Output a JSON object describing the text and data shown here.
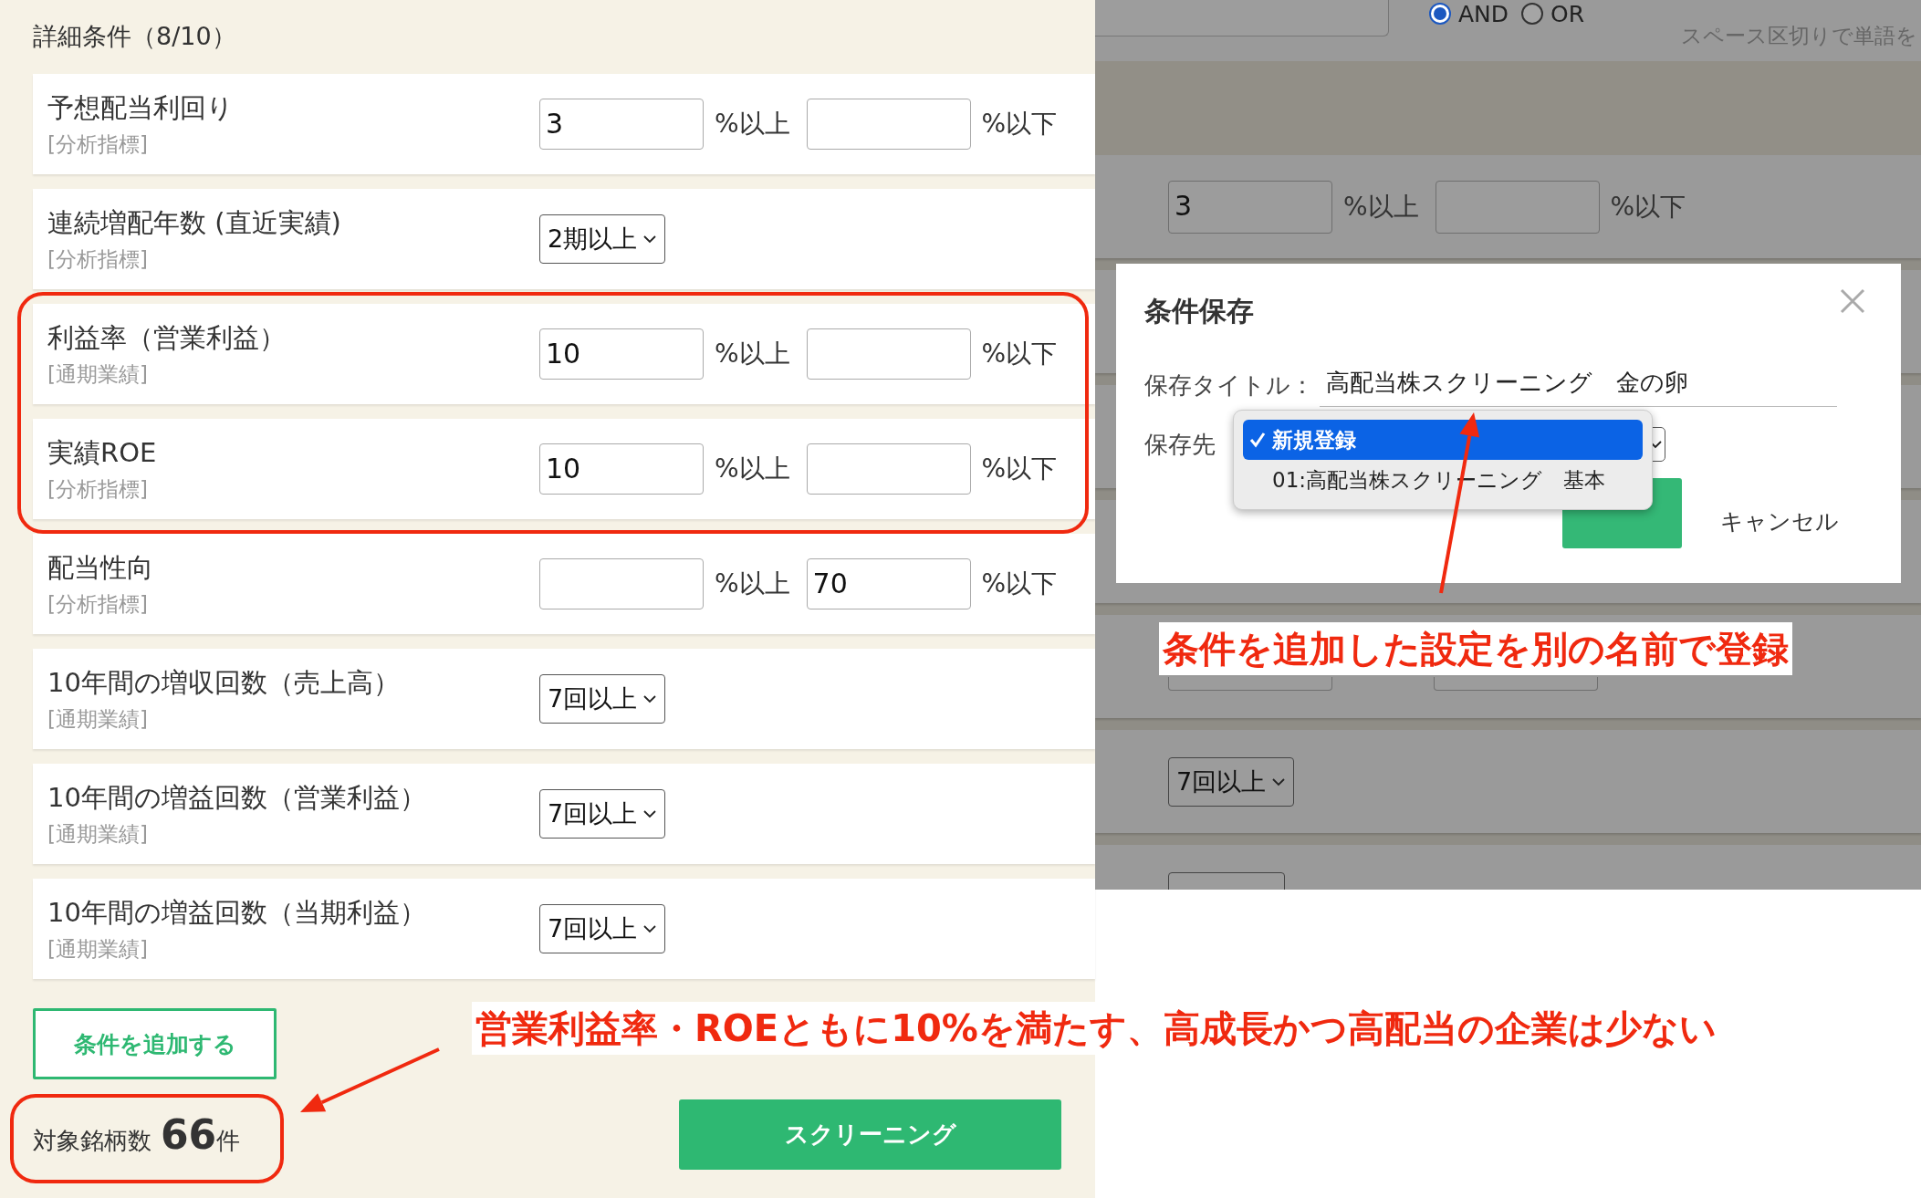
{
  "conditions_panel": {
    "heading": "詳細条件（8/10）",
    "rows": [
      {
        "kind": "range",
        "label": "予想配当利回り",
        "category": "[分析指標]",
        "min_value": "3",
        "min_suffix": "%以上",
        "max_suffix": "%以下"
      },
      {
        "kind": "select",
        "label": "連続増配年数 (直近実績)",
        "category": "[分析指標]",
        "value": "2期以上"
      },
      {
        "kind": "range",
        "label": "利益率（営業利益）",
        "category": "[通期業績]",
        "min_value": "10",
        "min_suffix": "%以上",
        "max_suffix": "%以下"
      },
      {
        "kind": "range",
        "label": "実績ROE",
        "category": "[分析指標]",
        "min_value": "10",
        "min_suffix": "%以上",
        "max_suffix": "%以下"
      },
      {
        "kind": "range",
        "label": "配当性向",
        "category": "[分析指標]",
        "min_suffix": "%以上",
        "max_value": "70",
        "max_suffix": "%以下"
      },
      {
        "kind": "select",
        "label": "10年間の増収回数（売上高）",
        "category": "[通期業績]",
        "value": "7回以上"
      },
      {
        "kind": "select",
        "label": "10年間の増益回数（営業利益）",
        "category": "[通期業績]",
        "value": "7回以上"
      },
      {
        "kind": "select",
        "label": "10年間の増益回数（当期利益）",
        "category": "[通期業績]",
        "value": "7回以上"
      }
    ],
    "add_button": "条件を追加する",
    "result": {
      "label": "対象銘柄数",
      "count": "66",
      "unit": "件"
    },
    "screening_button": "スクリーニング"
  },
  "background_page": {
    "radios": [
      {
        "label": "AND",
        "selected": true
      },
      {
        "label": "OR",
        "selected": false
      }
    ],
    "hint": "スペース区切りで単語を",
    "rows": [
      {
        "kind": "range",
        "min_value": "3",
        "min_suffix": "%以上",
        "max_suffix": "%以下"
      },
      {
        "kind": "range"
      },
      {
        "kind": "select",
        "value": "7回以上"
      },
      {
        "kind": "select"
      }
    ]
  },
  "save_dialog": {
    "title": "条件保存",
    "title_label": "保存タイトル：",
    "title_value": "高配当株スクリーニング　金の卵",
    "destination_label": "保存先",
    "destination_options": [
      {
        "label": "新規登録",
        "selected": true
      },
      {
        "label": "01:高配当株スクリーニング　基本",
        "selected": false
      }
    ],
    "cancel_button": "キャンセル"
  },
  "callouts": [
    {
      "text": "条件を追加した設定を別の名前で登録"
    },
    {
      "text": "営業利益率・ROEともに10%を満たす、高成長かつ高配当の企業は少ない"
    }
  ]
}
